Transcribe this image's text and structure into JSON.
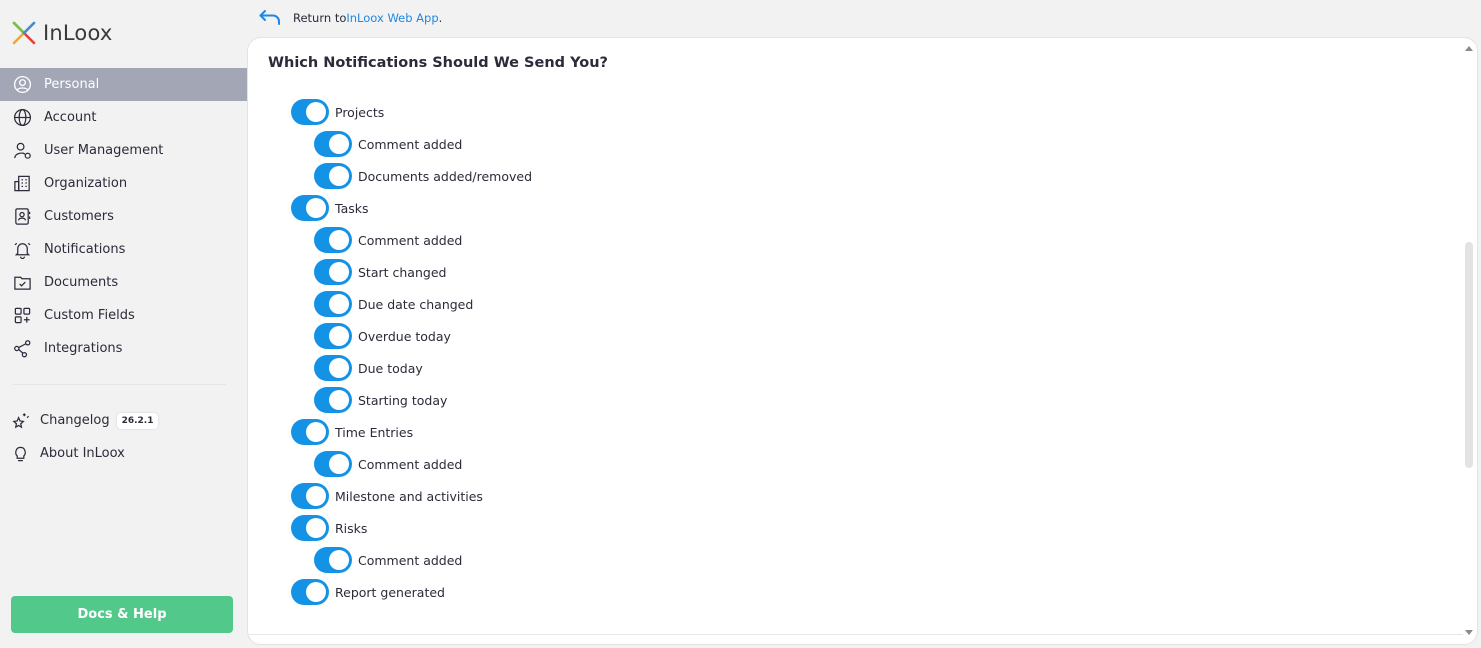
{
  "app": {
    "logo_text": "InLoox"
  },
  "return_link": {
    "prefix": "Return to ",
    "link_text": "InLoox Web App",
    "suffix": "."
  },
  "sidebar": {
    "items": [
      {
        "label": "Personal",
        "icon": "user-circle-icon",
        "active": true
      },
      {
        "label": "Account",
        "icon": "globe-icon"
      },
      {
        "label": "User Management",
        "icon": "user-settings-icon"
      },
      {
        "label": "Organization",
        "icon": "building-icon"
      },
      {
        "label": "Customers",
        "icon": "contact-book-icon"
      },
      {
        "label": "Notifications",
        "icon": "bell-icon"
      },
      {
        "label": "Documents",
        "icon": "folder-check-icon"
      },
      {
        "label": "Custom Fields",
        "icon": "grid-plus-icon"
      },
      {
        "label": "Integrations",
        "icon": "share-nodes-icon"
      }
    ],
    "secondary": [
      {
        "label": "Changelog",
        "icon": "sparkle-star-icon",
        "badge": "26.2.1"
      },
      {
        "label": "About InLoox",
        "icon": "lightbulb-icon"
      }
    ],
    "docs_button": "Docs & Help"
  },
  "main": {
    "title": "Which Notifications Should We Send You?",
    "toggles": [
      {
        "label": "Projects",
        "level": 0,
        "on": true
      },
      {
        "label": "Comment added",
        "level": 1,
        "on": true
      },
      {
        "label": "Documents added/removed",
        "level": 1,
        "on": true
      },
      {
        "label": "Tasks",
        "level": 0,
        "on": true
      },
      {
        "label": "Comment added",
        "level": 1,
        "on": true
      },
      {
        "label": "Start changed",
        "level": 1,
        "on": true
      },
      {
        "label": "Due date changed",
        "level": 1,
        "on": true
      },
      {
        "label": "Overdue today",
        "level": 1,
        "on": true
      },
      {
        "label": "Due today",
        "level": 1,
        "on": true
      },
      {
        "label": "Starting today",
        "level": 1,
        "on": true
      },
      {
        "label": "Time Entries",
        "level": 0,
        "on": true
      },
      {
        "label": "Comment added",
        "level": 1,
        "on": true
      },
      {
        "label": "Milestone and activities",
        "level": 0,
        "on": true
      },
      {
        "label": "Risks",
        "level": 0,
        "on": true
      },
      {
        "label": "Comment added",
        "level": 1,
        "on": true
      },
      {
        "label": "Report generated",
        "level": 0,
        "on": true
      }
    ]
  },
  "colors": {
    "toggle_on": "#1492e6",
    "active_nav": "#a3a6b4",
    "docs_button": "#52c98a",
    "link": "#1e88e5"
  }
}
